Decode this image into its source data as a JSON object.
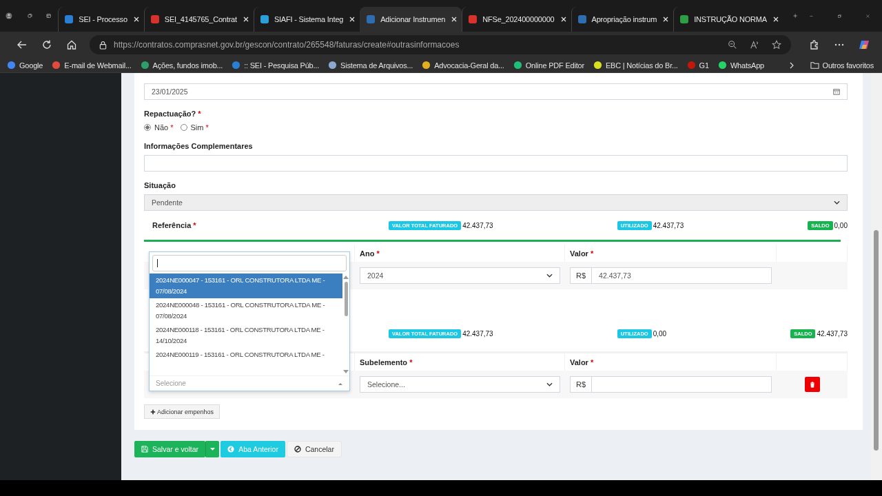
{
  "browser": {
    "tabs": [
      {
        "title": "SEI - Processo",
        "selected": false,
        "color": "#2a7fd4"
      },
      {
        "title": "SEI_4145765_Contrat",
        "selected": false,
        "color": "#d9322c"
      },
      {
        "title": "SIAFI - Sistema Integ",
        "selected": false,
        "color": "#2a9fd8"
      },
      {
        "title": "Adicionar Instrumen",
        "selected": true,
        "color": "#2f6db3"
      },
      {
        "title": "NFSe_202400000000",
        "selected": false,
        "color": "#d9322c"
      },
      {
        "title": "Apropriação instrum",
        "selected": false,
        "color": "#2f6db3"
      },
      {
        "title": "INSTRUÇÃO NORMA",
        "selected": false,
        "color": "#2e9e44"
      }
    ],
    "url": "https://contratos.comprasnet.gov.br/gescon/contrato/265548/faturas/create#outrasinformacoes",
    "bookmarks": [
      {
        "label": "Google",
        "color": "#4285f4"
      },
      {
        "label": "E-mail de Webmail...",
        "color": "#e04a3f"
      },
      {
        "label": "Ações, fundos imob...",
        "color": "#2e9e6a"
      },
      {
        "label": ":: SEI - Pesquisa Púb...",
        "color": "#2a7fd4"
      },
      {
        "label": "Sistema de Arquivos...",
        "color": "#8aa8d0"
      },
      {
        "label": "Advocacia-Geral da...",
        "color": "#e0b020"
      },
      {
        "label": "Online PDF Editor",
        "color": "#1fbf7a"
      },
      {
        "label": "EBC | Notícias do Br...",
        "color": "#d8e020"
      },
      {
        "label": "G1",
        "color": "#c4170c"
      },
      {
        "label": "WhatsApp",
        "color": "#25d366"
      }
    ],
    "other_bookmarks": "Outros favoritos"
  },
  "form": {
    "due_date": "23/01/2025",
    "repactuacao": {
      "label": "Repactuação?",
      "mark": "*",
      "options": [
        {
          "label": "Não",
          "mark": "*",
          "selected": true
        },
        {
          "label": "Sim",
          "mark": "*",
          "selected": false
        }
      ]
    },
    "info": {
      "label": "Informações Complementares"
    },
    "situacao": {
      "label": "Situação",
      "value": "Pendente"
    },
    "sections": [
      {
        "title": "Referência",
        "mark": "*",
        "line": true,
        "badges": [
          {
            "label": "VALOR TOTAL FATURADO",
            "value": "42.437,73",
            "kind": "info"
          },
          {
            "label": "UTILIZADO",
            "value": "42.437,73",
            "kind": "info"
          },
          {
            "label": "SALDO",
            "value": "0,00",
            "kind": "success"
          }
        ],
        "columns": [
          {
            "label": "Ano",
            "mark": "*"
          },
          {
            "label": "Valor",
            "mark": "*"
          }
        ],
        "row": {
          "select": "2024",
          "currency": "R$",
          "value": "42.437,73",
          "delete": false
        }
      },
      {
        "line": false,
        "badges": [
          {
            "label": "VALOR TOTAL FATURADO",
            "value": "42.437,73",
            "kind": "info"
          },
          {
            "label": "UTILIZADO",
            "value": "0,00",
            "kind": "info"
          },
          {
            "label": "SALDO",
            "value": "42.437,73",
            "kind": "success"
          }
        ],
        "columns": [
          {
            "label": "Subelemento",
            "mark": "*"
          },
          {
            "label": "Valor",
            "mark": "*"
          }
        ],
        "row": {
          "select": "Selecione...",
          "currency": "R$",
          "delete": true
        }
      }
    ],
    "add_button": "Adicionar empenhos",
    "dropdown": {
      "options": [
        {
          "label": "2024NE000047 - 153161 - ORL CONSTRUTORA LTDA ME - 07/08/2024",
          "selected": true
        },
        {
          "label": "2024NE000048 - 153161 - ORL CONSTRUTORA LTDA ME - 07/08/2024",
          "selected": false
        },
        {
          "label": "2024NE000118 - 153161 - ORL CONSTRUTORA LTDA ME - 14/10/2024",
          "selected": false
        },
        {
          "label": "2024NE000119 - 153161 - ORL CONSTRUTORA LTDA ME -",
          "selected": false
        }
      ],
      "placeholder": "Selecione"
    }
  },
  "actions": [
    {
      "label": "Salvar e voltar",
      "kind": "save"
    },
    {
      "label": "Aba Anterior",
      "kind": "back"
    },
    {
      "label": "Cancelar",
      "kind": "cancel"
    }
  ]
}
